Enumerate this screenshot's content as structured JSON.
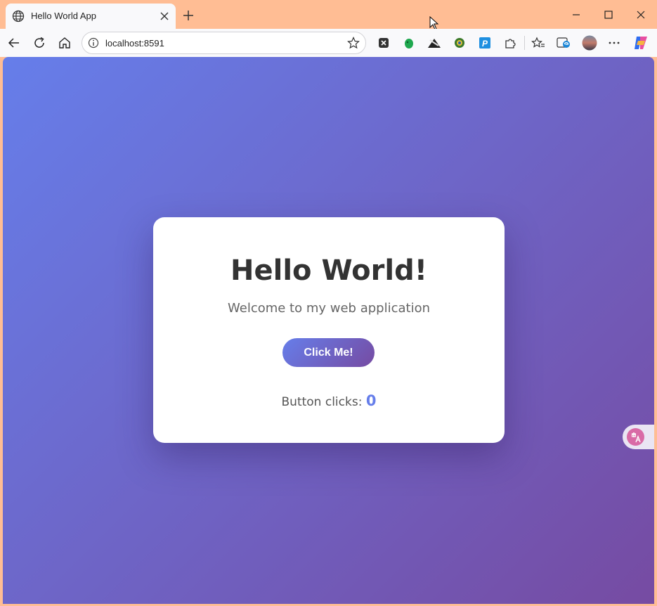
{
  "browser": {
    "tab_title": "Hello World App",
    "address_url": "localhost:8591"
  },
  "page": {
    "heading": "Hello World!",
    "subtitle": "Welcome to my web application",
    "button_label": "Click Me!",
    "counter_label": "Button clicks:",
    "counter_value": "0"
  },
  "colors": {
    "gradient_start": "#667eea",
    "gradient_end": "#764ba2",
    "title_bar": "#ffbd94"
  },
  "icons": {
    "tab": [
      "globe-icon",
      "close-icon",
      "plus-icon"
    ],
    "window": [
      "minimize-icon",
      "maximize-icon",
      "close-window-icon"
    ],
    "toolbar": [
      "back-icon",
      "refresh-icon",
      "home-icon",
      "info-icon",
      "star-icon"
    ],
    "extensions": [
      "x-extension-icon",
      "evernote-icon",
      "extension-icon",
      "extension-icon",
      "p-extension-icon",
      "puzzle-icon",
      "favorites-icon",
      "edge-bar-icon",
      "profile-avatar",
      "more-icon",
      "copilot-icon"
    ],
    "floating": "translate-icon"
  }
}
